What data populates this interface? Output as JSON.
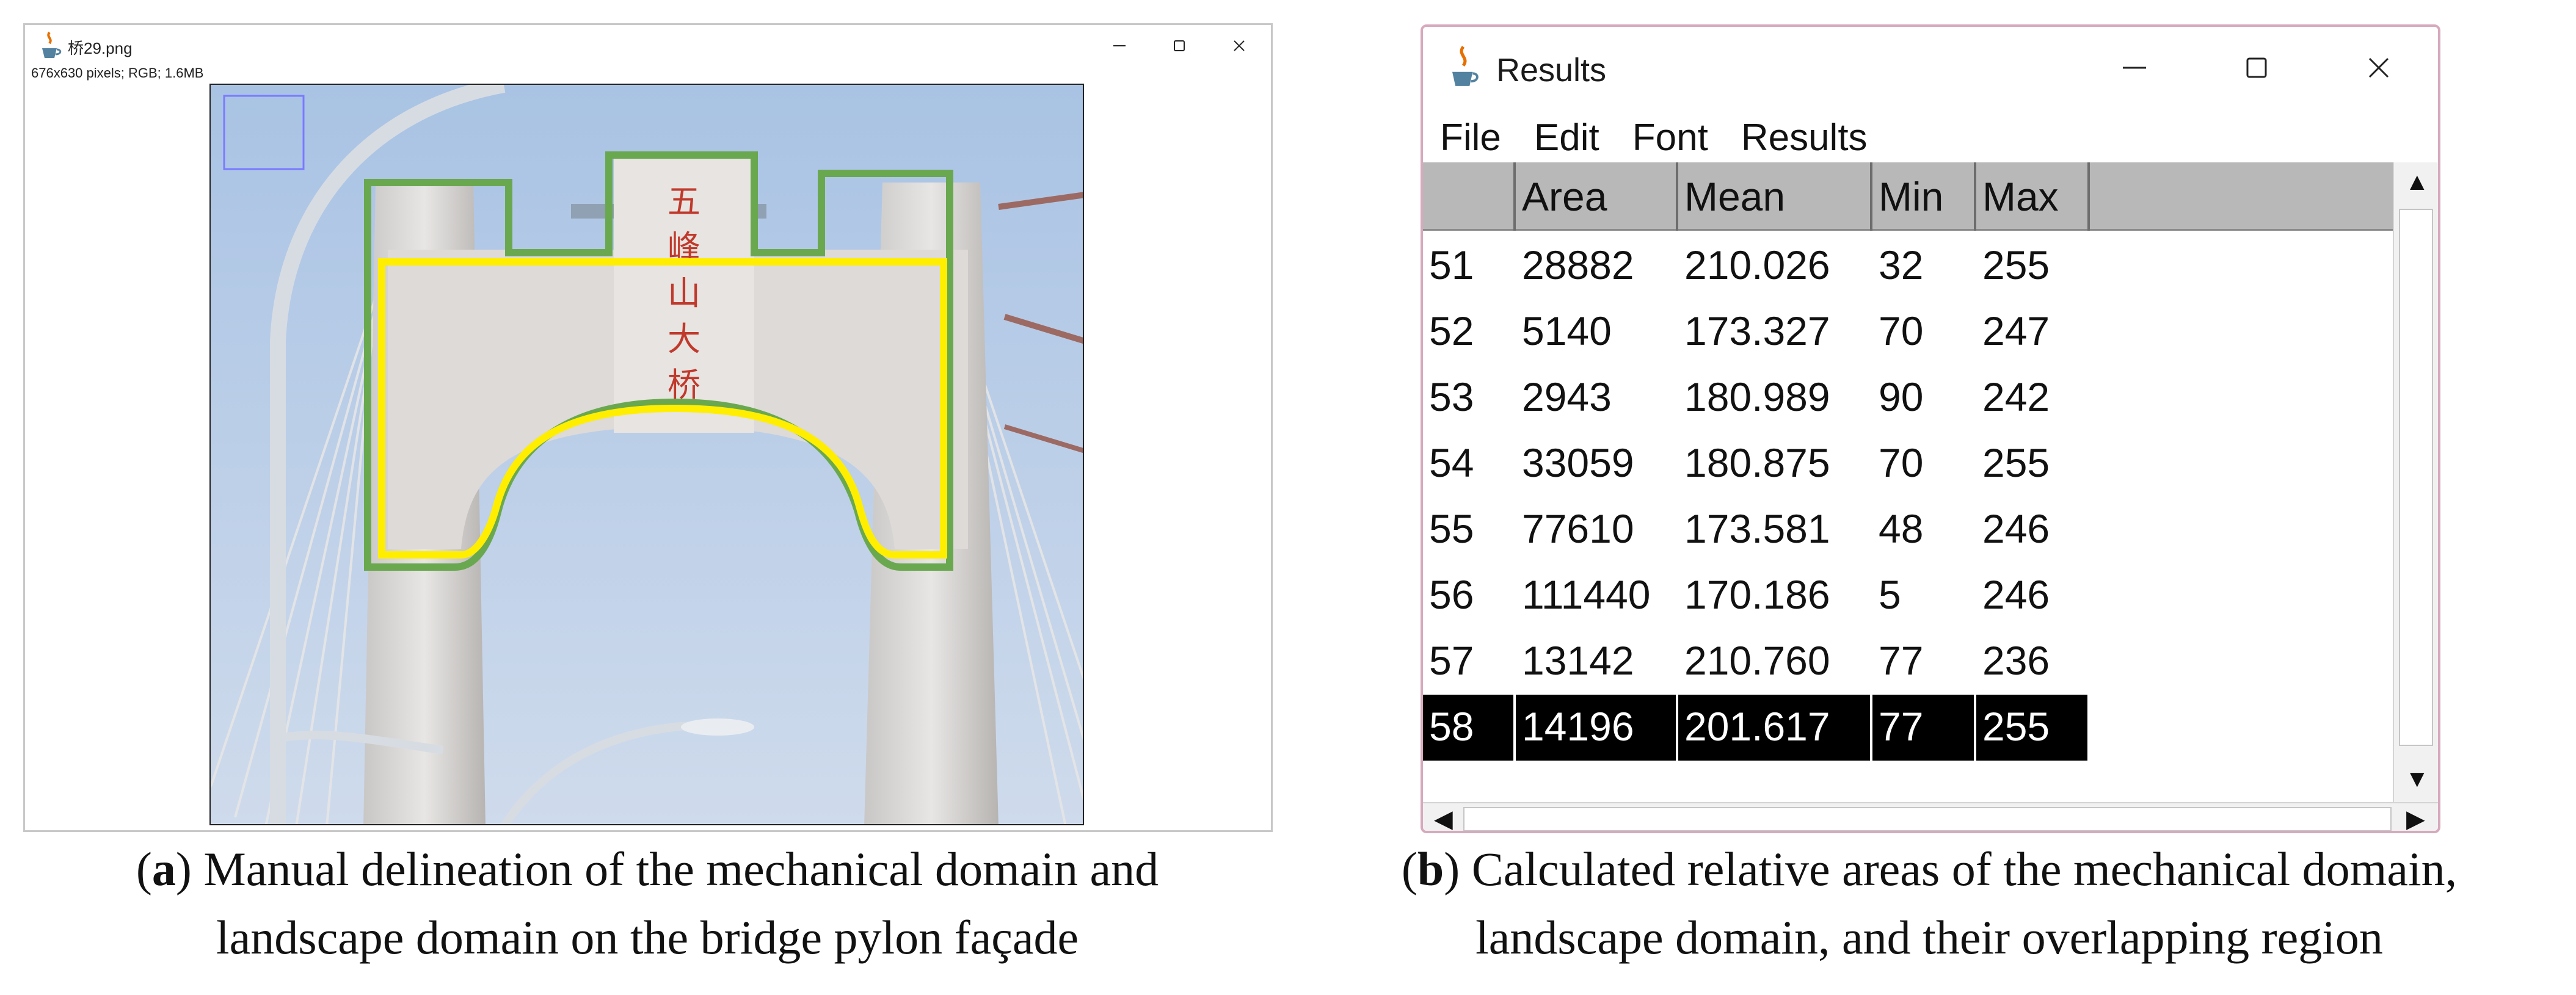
{
  "viewer": {
    "title": "桥29.png",
    "info": "676x630 pixels; RGB; 1.6MB",
    "sign_chars": [
      "五",
      "峰",
      "山",
      "大",
      "桥"
    ],
    "controls": {
      "minimize": "–",
      "maximize": "☐",
      "close": "✕"
    },
    "outline_colors": {
      "mechanical_domain": "#6aa84f",
      "landscape_domain": "#ffee00"
    }
  },
  "results": {
    "title": "Results",
    "controls": {
      "minimize": "–",
      "maximize": "☐",
      "close": "✕"
    },
    "menu": [
      "File",
      "Edit",
      "Font",
      "Results"
    ],
    "columns": [
      "",
      "Area",
      "Mean",
      "Min",
      "Max"
    ],
    "rows": [
      [
        "51",
        "28882",
        "210.026",
        "32",
        "255"
      ],
      [
        "52",
        "5140",
        "173.327",
        "70",
        "247"
      ],
      [
        "53",
        "2943",
        "180.989",
        "90",
        "242"
      ],
      [
        "54",
        "33059",
        "180.875",
        "70",
        "255"
      ],
      [
        "55",
        "77610",
        "173.581",
        "48",
        "246"
      ],
      [
        "56",
        "111440",
        "170.186",
        "5",
        "246"
      ],
      [
        "57",
        "13142",
        "210.760",
        "77",
        "236"
      ],
      [
        "58",
        "14196",
        "201.617",
        "77",
        "255"
      ]
    ],
    "selected_row": "58",
    "scroll_arrows": {
      "up": "▲",
      "down": "▼",
      "left": "◀",
      "right": "▶"
    }
  },
  "captions": {
    "a_letter": "a",
    "a_line1": "Manual delineation of the mechanical domain and",
    "a_line2": "landscape domain on the bridge pylon façade",
    "b_letter": "b",
    "b_line1": "Calculated relative areas of the mechanical domain,",
    "b_line2": "landscape domain, and their overlapping region"
  }
}
